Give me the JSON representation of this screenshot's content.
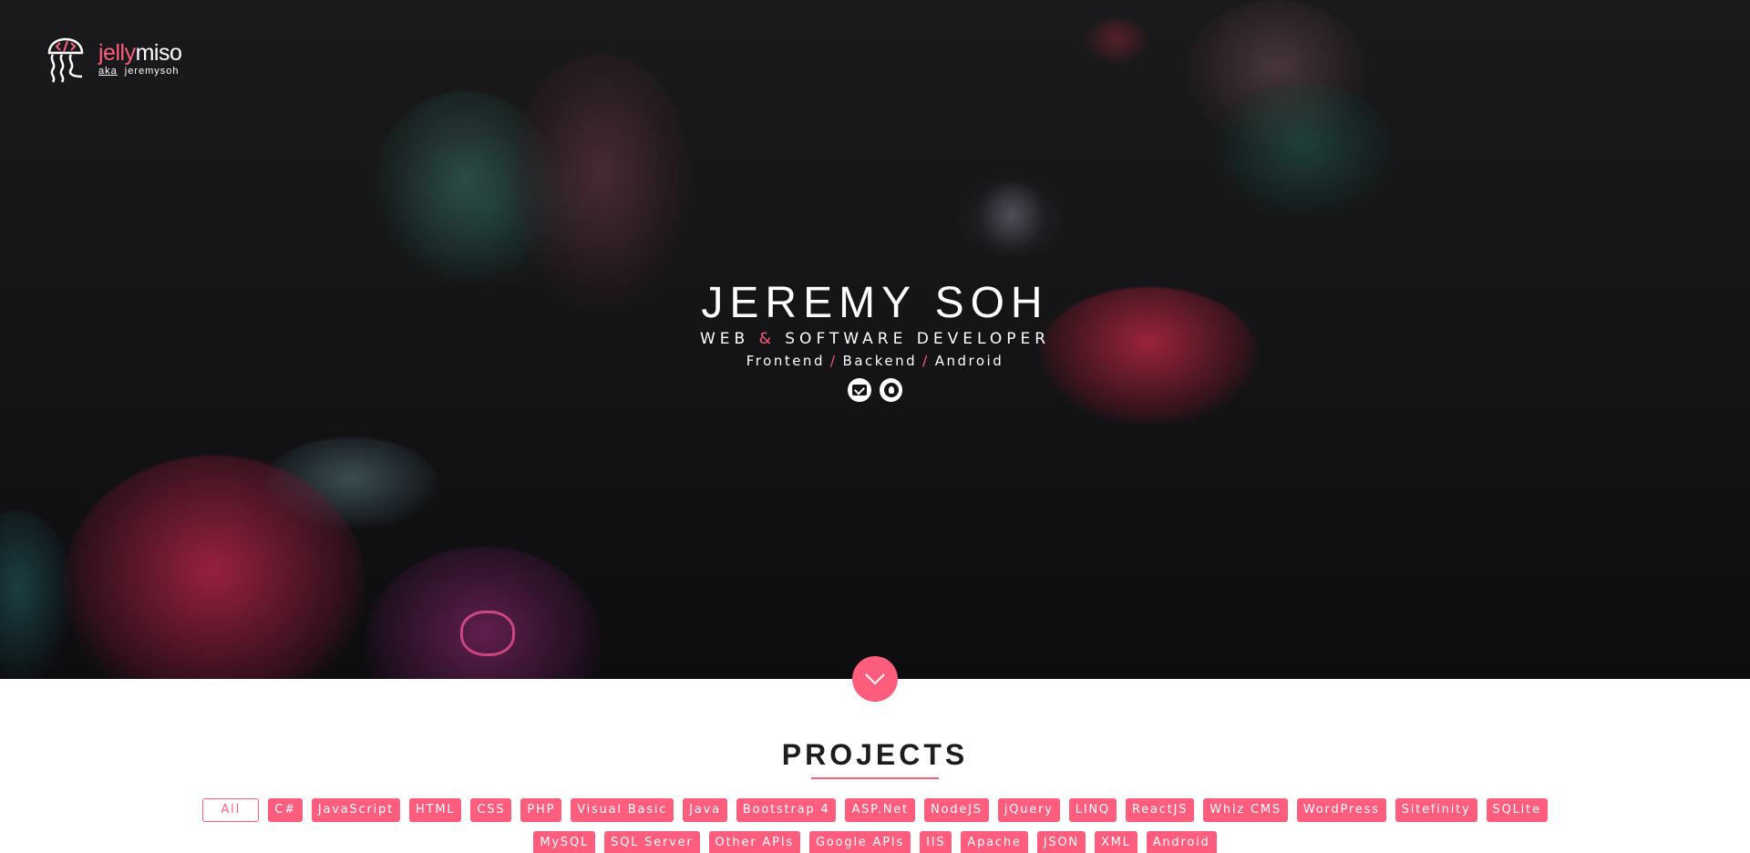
{
  "logo": {
    "brand_light": "jelly",
    "brand_bold": "miso",
    "aka": "aka",
    "handle": "jeremysoh"
  },
  "hero": {
    "name": "JEREMY SOH",
    "role_part1": "WEB",
    "role_amp": "&",
    "role_part2": "SOFTWARE DEVELOPER",
    "stack": [
      "Frontend",
      "Backend",
      "Android"
    ],
    "separator": "/"
  },
  "socials": [
    {
      "icon": "mail-icon"
    },
    {
      "icon": "github-icon"
    }
  ],
  "scroll_button": {
    "icon": "chevron-down-icon"
  },
  "projects": {
    "title": "PROJECTS",
    "filters": [
      "All",
      "C#",
      "JavaScript",
      "HTML",
      "CSS",
      "PHP",
      "Visual Basic",
      "Java",
      "Bootstrap 4",
      "ASP.Net",
      "NodeJS",
      "jQuery",
      "LINQ",
      "ReactJS",
      "Whiz CMS",
      "WordPress",
      "Sitefinity",
      "SQLite",
      "MySQL",
      "SQL Server",
      "Other APIs",
      "Google APIs",
      "IIS",
      "Apache",
      "JSON",
      "XML",
      "Android"
    ],
    "active_filter": "All"
  },
  "colors": {
    "accent": "#ff5d7d",
    "hero_bg": "#141416",
    "title": "#1d1d1f"
  }
}
